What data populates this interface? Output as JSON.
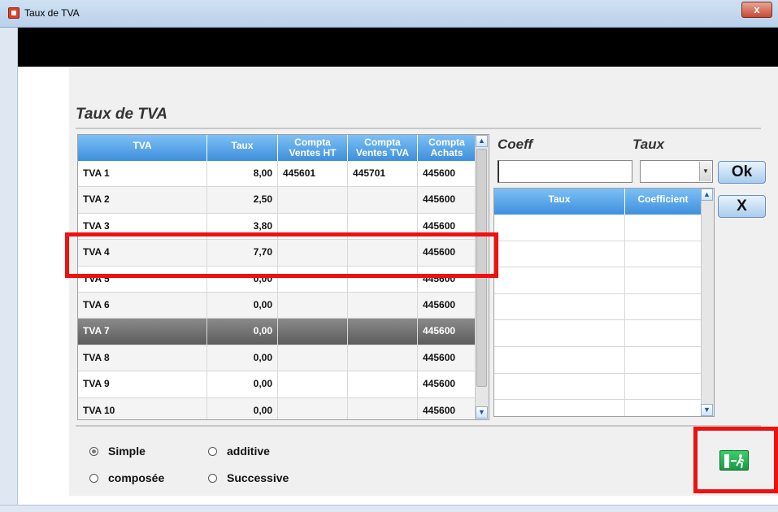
{
  "window": {
    "title": "Taux de TVA",
    "close_label": "x"
  },
  "section_title": "Taux de TVA",
  "grid": {
    "columns": [
      "TVA",
      "Taux",
      "Compta\nVentes HT",
      "Compta\nVentes TVA",
      "Compta\nAchats"
    ],
    "rows": [
      [
        "TVA 1",
        "8,00",
        "445601",
        "445701",
        "445600"
      ],
      [
        "TVA 2",
        "2,50",
        "",
        "",
        "445600"
      ],
      [
        "TVA 3",
        "3,80",
        "",
        "",
        "445600"
      ],
      [
        "TVA 4",
        "7,70",
        "",
        "",
        "445600"
      ],
      [
        "TVA 5",
        "0,00",
        "",
        "",
        "445600"
      ],
      [
        "TVA 6",
        "0,00",
        "",
        "",
        "445600"
      ],
      [
        "TVA 7",
        "0,00",
        "",
        "",
        "445600"
      ],
      [
        "TVA 8",
        "0,00",
        "",
        "",
        "445600"
      ],
      [
        "TVA 9",
        "0,00",
        "",
        "",
        "445600"
      ],
      [
        "TVA 10",
        "0,00",
        "",
        "",
        "445600"
      ]
    ],
    "selected_row": "TVA 7",
    "highlighted_row": "TVA 4"
  },
  "coeff": {
    "label": "Coeff",
    "value": ""
  },
  "taux": {
    "label": "Taux",
    "value": ""
  },
  "buttons": {
    "ok": "Ok",
    "x": "X"
  },
  "grid2": {
    "columns": [
      "Taux",
      "Coefficient"
    ],
    "rows": [
      [
        "",
        ""
      ],
      [
        "",
        ""
      ],
      [
        "",
        ""
      ],
      [
        "",
        ""
      ],
      [
        "",
        ""
      ],
      [
        "",
        ""
      ],
      [
        "",
        ""
      ],
      [
        "",
        ""
      ]
    ]
  },
  "radios": [
    {
      "label": "Simple",
      "checked": true
    },
    {
      "label": "additive",
      "checked": false
    },
    {
      "label": "composée",
      "checked": false
    },
    {
      "label": "Successive",
      "checked": false
    }
  ],
  "colors": {
    "header_blue": "#3f8fdc",
    "highlight_red": "#f01010",
    "exit_green": "#1a9a43"
  },
  "icons": {
    "exit": "exit-door-icon"
  }
}
